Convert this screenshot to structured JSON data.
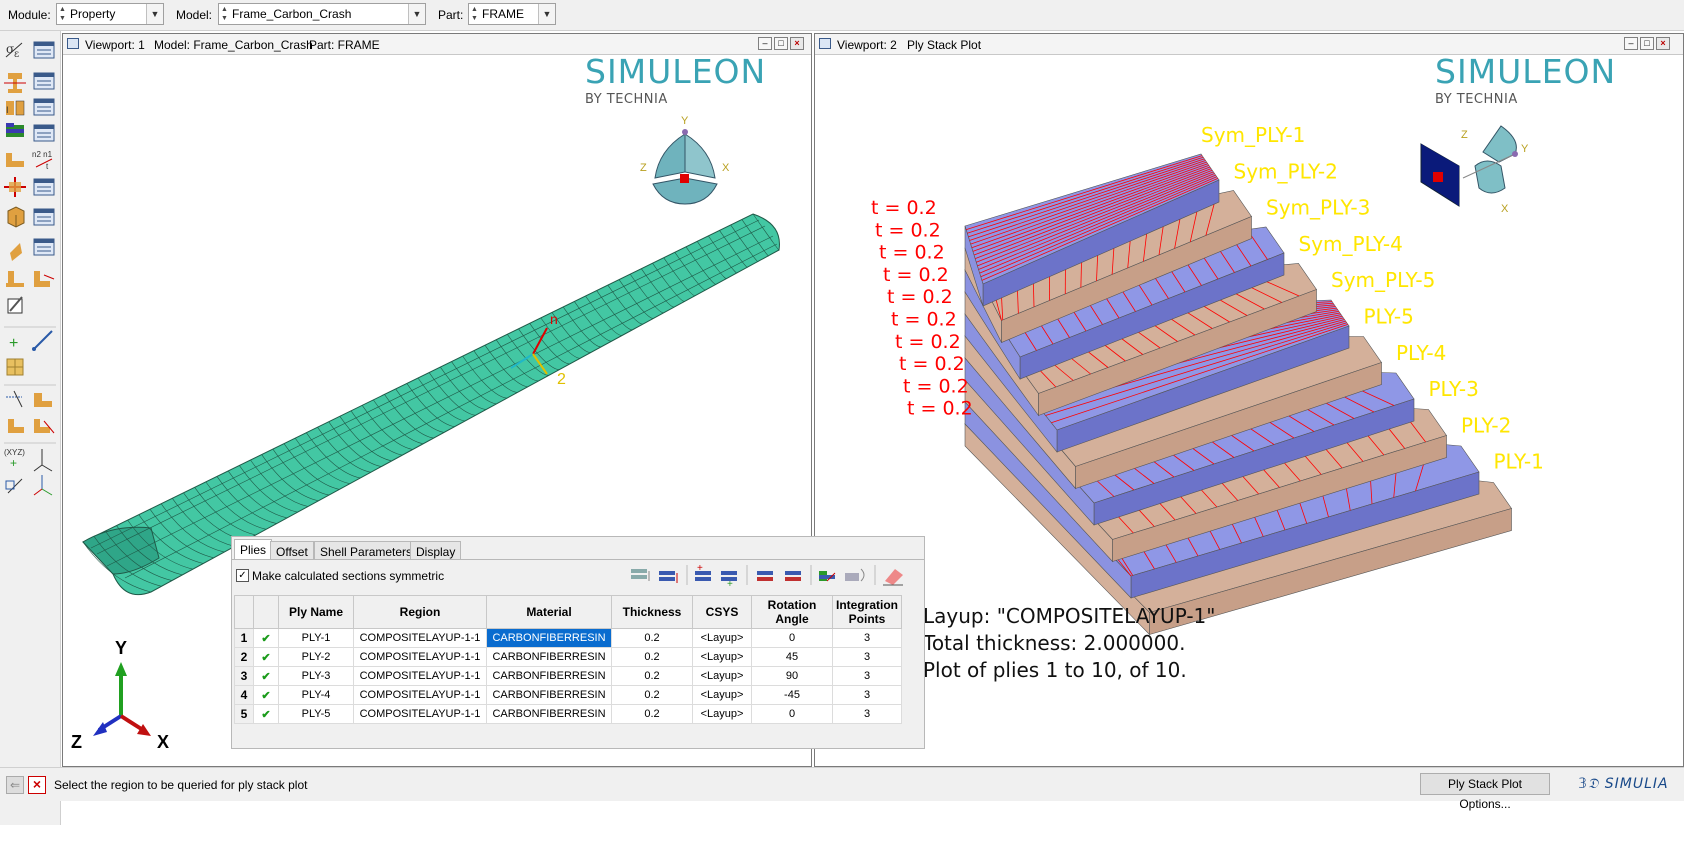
{
  "toolbar": {
    "module_label": "Module:",
    "module_value": "Property",
    "model_label": "Model:",
    "model_value": "Frame_Carbon_Crash",
    "part_label": "Part:",
    "part_value": "FRAME"
  },
  "viewport1": {
    "title": "Viewport: 1",
    "model": "Model: Frame_Carbon_Crash",
    "part": "Part: FRAME",
    "brand": "SIMULEON",
    "brand_sub": "BY TECHNIA",
    "triad_y": "Y",
    "triad_z": "Z",
    "triad_x": "X",
    "mat_axis_n": "n",
    "mat_axis_2": "2",
    "global_y": "Y",
    "global_z": "Z",
    "global_x": "X",
    "mesh_color": "#43c7a3"
  },
  "viewport2": {
    "title": "Viewport: 2",
    "subtitle": "Ply Stack Plot",
    "brand": "SIMULEON",
    "brand_sub": "BY TECHNIA",
    "triad_z": "Z",
    "triad_y": "Y",
    "triad_x": "X",
    "thickness_labels": [
      "t = 0.2",
      "t = 0.2",
      "t = 0.2",
      "t = 0.2",
      "t = 0.2",
      "t = 0.2",
      "t = 0.2",
      "t = 0.2",
      "t = 0.2",
      "t = 0.2"
    ],
    "ply_labels": [
      "Sym_PLY-1",
      "Sym_PLY-2",
      "Sym_PLY-3",
      "Sym_PLY-4",
      "Sym_PLY-5",
      "PLY-5",
      "PLY-4",
      "PLY-3",
      "PLY-2",
      "PLY-1"
    ],
    "layup_line": "Layup: \"COMPOSITELAYUP-1\"",
    "thickness_line": "Total thickness: 2.000000.",
    "plot_line": "Plot of plies 1 to 10, of 10.",
    "colors": {
      "blue_ply": "#8f97e6",
      "tan_ply": "#d4b09a",
      "fiber_line": "#ff0000",
      "label_red": "#ff0000",
      "label_yellow": "#ffe600"
    }
  },
  "editor": {
    "tabs": [
      "Plies",
      "Offset",
      "Shell Parameters",
      "Display"
    ],
    "symmetric_label": "Make calculated sections symmetric",
    "columns": [
      "Ply Name",
      "Region",
      "Material",
      "Thickness",
      "CSYS",
      "Rotation Angle",
      "Integration Points"
    ],
    "rows": [
      {
        "num": "1",
        "name": "PLY-1",
        "region": "COMPOSITELAYUP-1-1",
        "material": "CARBONFIBERRESIN",
        "thickness": "0.2",
        "csys": "<Layup>",
        "angle": "0",
        "points": "3"
      },
      {
        "num": "2",
        "name": "PLY-2",
        "region": "COMPOSITELAYUP-1-1",
        "material": "CARBONFIBERRESIN",
        "thickness": "0.2",
        "csys": "<Layup>",
        "angle": "45",
        "points": "3"
      },
      {
        "num": "3",
        "name": "PLY-3",
        "region": "COMPOSITELAYUP-1-1",
        "material": "CARBONFIBERRESIN",
        "thickness": "0.2",
        "csys": "<Layup>",
        "angle": "90",
        "points": "3"
      },
      {
        "num": "4",
        "name": "PLY-4",
        "region": "COMPOSITELAYUP-1-1",
        "material": "CARBONFIBERRESIN",
        "thickness": "0.2",
        "csys": "<Layup>",
        "angle": "-45",
        "points": "3"
      },
      {
        "num": "5",
        "name": "PLY-5",
        "region": "COMPOSITELAYUP-1-1",
        "material": "CARBONFIBERRESIN",
        "thickness": "0.2",
        "csys": "<Layup>",
        "angle": "0",
        "points": "3"
      }
    ]
  },
  "status": {
    "prompt": "Select the region to be queried for ply stack plot",
    "options_button": "Ply Stack Plot Options...",
    "logo": "SIMULIA"
  }
}
